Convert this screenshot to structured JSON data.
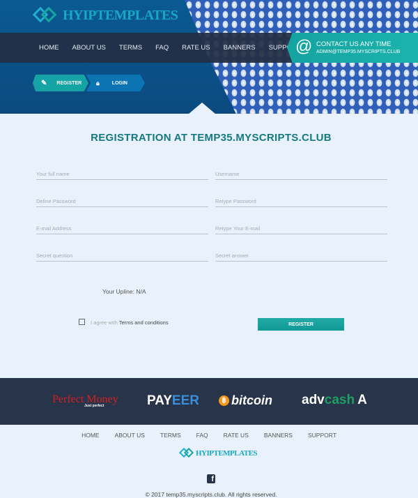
{
  "brand": {
    "logo_text": "HYIPTEMPLATES"
  },
  "nav": [
    "HOME",
    "ABOUT US",
    "TERMS",
    "FAQ",
    "RATE US",
    "BANNERS",
    "SUPPORT"
  ],
  "contact": {
    "title": "CONTACT US ANY TIME",
    "email": "ADMIN@TEMP35.MYSCRIPTS.CLUB",
    "icon": "at-icon"
  },
  "tabs": {
    "register": "REGISTER",
    "login": "LOGIN"
  },
  "form": {
    "title": "REGISTRATION AT TEMP35.MYSCRIPTS.CLUB",
    "fields": [
      {
        "placeholder": "Your full name",
        "value": ""
      },
      {
        "placeholder": "Username",
        "value": ""
      },
      {
        "placeholder": "Define Password",
        "value": ""
      },
      {
        "placeholder": "Retype Password",
        "value": ""
      },
      {
        "placeholder": "E-mail Address",
        "value": ""
      },
      {
        "placeholder": "Retype Your E-mail",
        "value": ""
      },
      {
        "placeholder": "Secret question",
        "value": ""
      },
      {
        "placeholder": "Secret answer",
        "value": ""
      }
    ],
    "upline": "Your Upline: N/A",
    "agree_prefix": "I agree with ",
    "agree_link": "Terms and conditions",
    "agree_checked": false,
    "submit": "REGISTER"
  },
  "payments": {
    "pm": "Perfect Money",
    "pm_sub": "Just perfect",
    "payeer_a": "PAY",
    "payeer_b": "EER",
    "bitcoin": "bitcoin",
    "adv_a": "adv",
    "adv_b": "cash"
  },
  "footer": {
    "copyright": "© 2017 temp35.myscripts.club. All rights reserved.",
    "social": "facebook-icon"
  },
  "colors": {
    "accent": "#16a3a3",
    "header": "#0b4f86",
    "dark": "#283449",
    "title": "#16797f"
  }
}
